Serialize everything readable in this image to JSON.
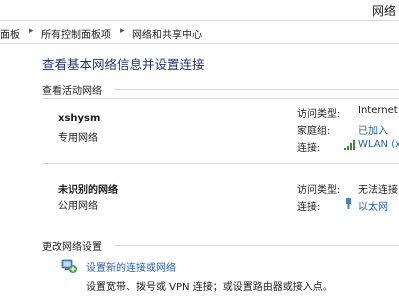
{
  "window": {
    "title": "网络"
  },
  "breadcrumb": {
    "items": [
      "面板",
      "所有控制面板项",
      "网络和共享中心"
    ],
    "separator": "▸"
  },
  "main": {
    "title": "查看基本网络信息并设置连接",
    "active_networks_header": "查看活动网络",
    "labels": {
      "access_type": "访问类型:",
      "homegroup": "家庭组:",
      "connections": "连接:"
    },
    "networks": [
      {
        "name": "xshysm",
        "category": "专用网络",
        "access_type": "Internet",
        "homegroup": "已加入",
        "connection": "WLAN (x",
        "connection_icon": "wifi-signal-icon"
      },
      {
        "name": "未识别的网络",
        "category": "公用网络",
        "access_type": "无法连接",
        "connection": "以太网",
        "connection_icon": "ethernet-icon"
      }
    ],
    "change_settings_header": "更改网络设置",
    "tasks": [
      {
        "link": "设置新的连接或网络",
        "description": "设置宽带、拨号或 VPN 连接；或设置路由器或接入点。",
        "icon": "new-connection-icon"
      }
    ]
  },
  "colors": {
    "link": "#1f5fc6",
    "title": "#1e3287",
    "rule": "#d4d9e2",
    "border": "#d9d9d9"
  }
}
